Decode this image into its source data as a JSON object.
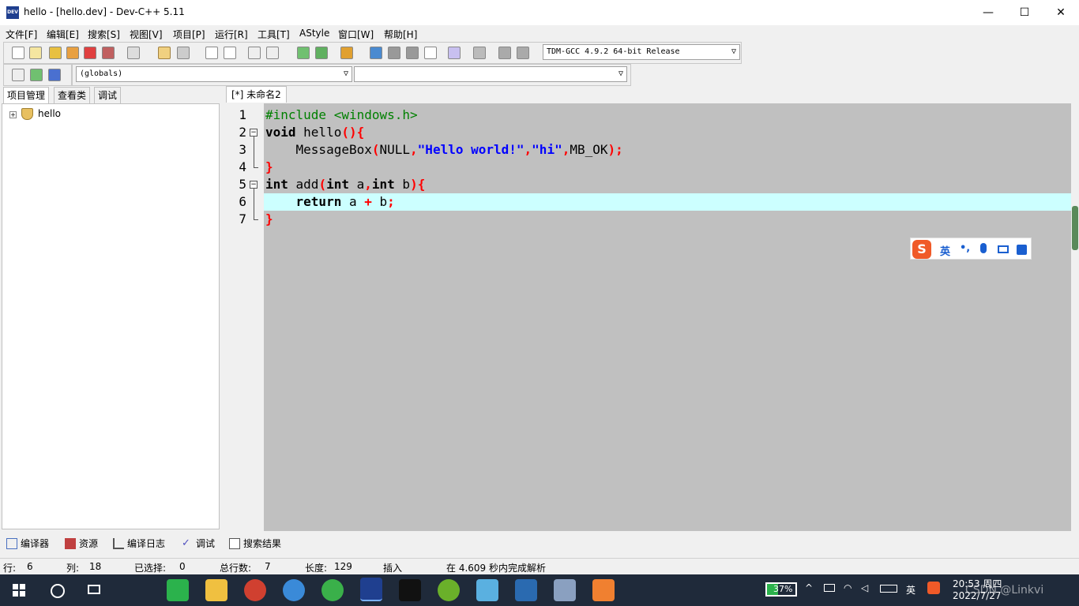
{
  "window": {
    "title": "hello - [hello.dev] - Dev-C++ 5.11",
    "app_icon_text": "DEV",
    "minimize": "—",
    "maximize": "☐",
    "close": "✕"
  },
  "menu": [
    "文件[F]",
    "编辑[E]",
    "搜索[S]",
    "视图[V]",
    "项目[P]",
    "运行[R]",
    "工具[T]",
    "AStyle",
    "窗口[W]",
    "帮助[H]"
  ],
  "toolbar": {
    "compiler_select": "TDM-GCC 4.9.2 64-bit Release",
    "globals_select": "(globals)",
    "member_select": ""
  },
  "left_panel": {
    "tabs": [
      "项目管理",
      "查看类",
      "调试"
    ],
    "tree_root": "hello",
    "expand_glyph": "+"
  },
  "editor": {
    "tab_label": "[*] 未命名2",
    "line_numbers": [
      "1",
      "2",
      "3",
      "4",
      "5",
      "6",
      "7"
    ],
    "code_lines": [
      "#include <windows.h>",
      "void hello(){",
      "    MessageBox(NULL,\"Hello world!\",\"hi\",MB_OK);",
      "}",
      "int add(int a,int b){",
      "    return a + b;",
      "}"
    ],
    "current_line": 6
  },
  "ime": {
    "logo": "S",
    "lang": "英",
    "punct": "•,"
  },
  "bottom_tabs": [
    "编译器",
    "资源",
    "编译日志",
    "调试",
    "搜索结果"
  ],
  "status": {
    "row_label": "行:",
    "row_value": "6",
    "col_label": "列:",
    "col_value": "18",
    "sel_label": "已选择:",
    "sel_value": "0",
    "total_label": "总行数:",
    "total_value": "7",
    "len_label": "长度:",
    "len_value": "129",
    "mode": "插入",
    "parse_msg": "在 4.609 秒内完成解析"
  },
  "taskbar": {
    "battery": "37%",
    "lang": "英",
    "time": "20:53 周四",
    "date": "2022/7/27",
    "watermark": "CSDN @Linkvi"
  },
  "colors": {
    "editor_bg": "#c0c0c0",
    "current_line_bg": "#ccffff",
    "preprocessor": "#008000",
    "string": "#0000ff",
    "symbol": "#ff0000",
    "taskbar_bg": "#1f2a3a"
  }
}
